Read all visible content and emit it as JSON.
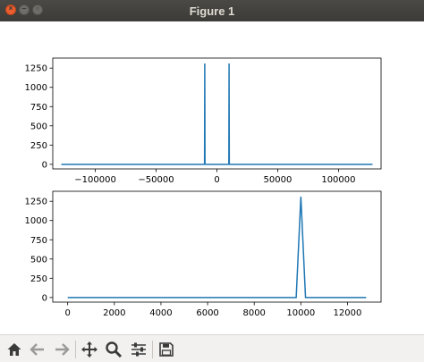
{
  "window": {
    "title": "Figure 1"
  },
  "toolbar": {
    "buttons": [
      {
        "name": "home-button",
        "icon": "home-icon"
      },
      {
        "name": "back-button",
        "icon": "arrow-left-icon"
      },
      {
        "name": "forward-button",
        "icon": "arrow-right-icon"
      },
      {
        "name": "pan-button",
        "icon": "move-icon"
      },
      {
        "name": "zoom-button",
        "icon": "magnifier-icon"
      },
      {
        "name": "configure-subplots-button",
        "icon": "sliders-icon"
      },
      {
        "name": "save-button",
        "icon": "floppy-disk-icon"
      }
    ]
  },
  "colors": {
    "line": "#1f77b4",
    "titlebar": "#3c3b37",
    "toolbar": "#f2f1f0"
  },
  "chart_data": [
    {
      "type": "line",
      "xlim": [
        -135000,
        135000
      ],
      "ylim": [
        -60,
        1380
      ],
      "xticks": [
        -100000,
        -50000,
        0,
        50000,
        100000
      ],
      "xtick_labels": [
        "−100000",
        "−50000",
        "0",
        "50000",
        "100000"
      ],
      "yticks": [
        0,
        250,
        500,
        750,
        1000,
        1250
      ],
      "ytick_labels": [
        "0",
        "250",
        "500",
        "750",
        "1000",
        "1250"
      ],
      "series": [
        {
          "x": [
            -128000,
            -10200,
            -10000,
            -9800,
            9800,
            10000,
            10200,
            128000
          ],
          "y": [
            0,
            0,
            1310,
            0,
            0,
            1310,
            0,
            0
          ]
        }
      ]
    },
    {
      "type": "line",
      "xlim": [
        -640,
        13440
      ],
      "ylim": [
        -60,
        1380
      ],
      "xticks": [
        0,
        2000,
        4000,
        6000,
        8000,
        10000,
        12000
      ],
      "xtick_labels": [
        "0",
        "2000",
        "4000",
        "6000",
        "8000",
        "10000",
        "12000"
      ],
      "yticks": [
        0,
        250,
        500,
        750,
        1000,
        1250
      ],
      "ytick_labels": [
        "0",
        "250",
        "500",
        "750",
        "1000",
        "1250"
      ],
      "series": [
        {
          "x": [
            0,
            9800,
            10000,
            10200,
            12800
          ],
          "y": [
            0,
            0,
            1310,
            0,
            0
          ]
        }
      ]
    }
  ]
}
